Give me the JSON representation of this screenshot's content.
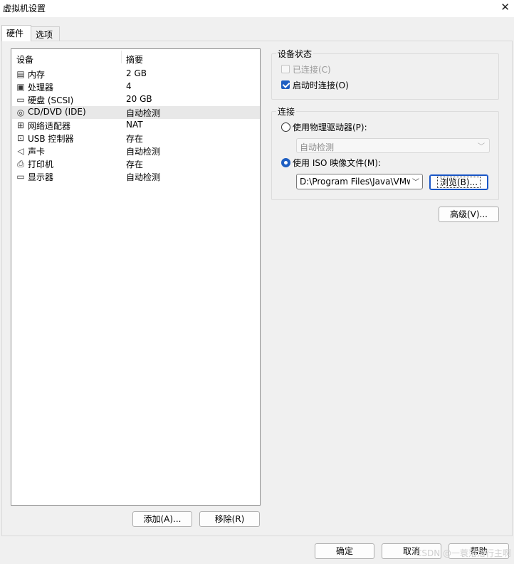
{
  "window": {
    "title": "虚拟机设置",
    "close_glyph": "✕"
  },
  "tabs": [
    {
      "label": "硬件",
      "active": true
    },
    {
      "label": "选项",
      "active": false
    }
  ],
  "device_list": {
    "headers": {
      "device": "设备",
      "summary": "摘要"
    },
    "items": [
      {
        "icon": "memory-icon",
        "glyph": "▤",
        "name": "内存",
        "summary": "2 GB"
      },
      {
        "icon": "processor-icon",
        "glyph": "▣",
        "name": "处理器",
        "summary": "4"
      },
      {
        "icon": "hard-disk-icon",
        "glyph": "▭",
        "name": "硬盘 (SCSI)",
        "summary": "20 GB"
      },
      {
        "icon": "cd-dvd-icon",
        "glyph": "◎",
        "name": "CD/DVD (IDE)",
        "summary": "自动检测",
        "selected": true
      },
      {
        "icon": "network-adapter-icon",
        "glyph": "⊞",
        "name": "网络适配器",
        "summary": "NAT"
      },
      {
        "icon": "usb-icon",
        "glyph": "⊡",
        "name": "USB 控制器",
        "summary": "存在"
      },
      {
        "icon": "sound-card-icon",
        "glyph": "◁",
        "name": "声卡",
        "summary": "自动检测"
      },
      {
        "icon": "printer-icon",
        "glyph": "⎙",
        "name": "打印机",
        "summary": "存在"
      },
      {
        "icon": "display-icon",
        "glyph": "▭",
        "name": "显示器",
        "summary": "自动检测"
      }
    ]
  },
  "list_buttons": {
    "add": "添加(A)...",
    "remove": "移除(R)"
  },
  "device_status": {
    "label": "设备状态",
    "connected": {
      "label": "已连接(C)",
      "checked": false,
      "disabled": true
    },
    "connect_at_power_on": {
      "label": "启动时连接(O)",
      "checked": true
    }
  },
  "connection": {
    "label": "连接",
    "physical_drive": {
      "label": "使用物理驱动器(P):",
      "selected": false
    },
    "physical_drive_select": "自动检测",
    "iso_file": {
      "label": "使用 ISO 映像文件(M):",
      "selected": true
    },
    "iso_path": "D:\\Program Files\\Java\\VMwa",
    "browse": "浏览(B)..."
  },
  "advanced": "高级(V)...",
  "footer": {
    "ok": "确定",
    "cancel": "取消",
    "help": "帮助"
  },
  "watermark": "CSDN @一蓑落落行主啊"
}
